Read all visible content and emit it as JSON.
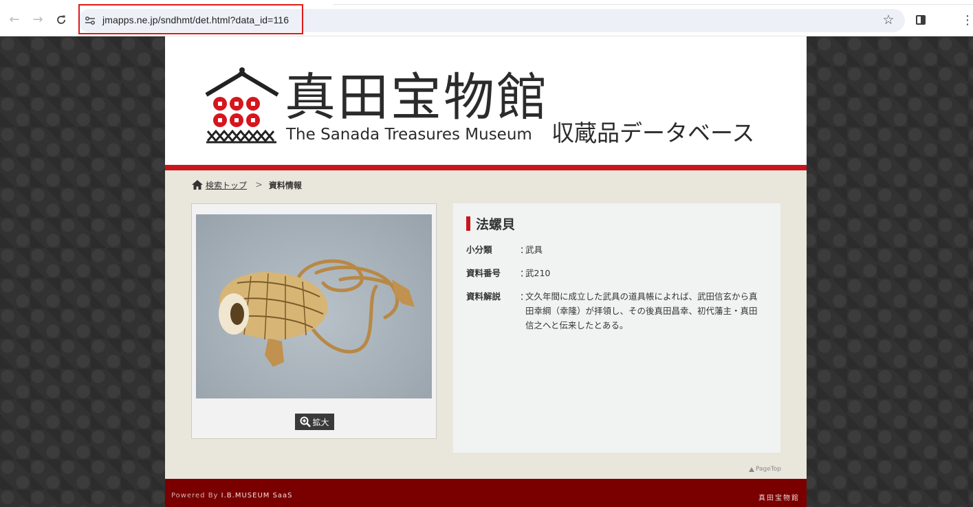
{
  "browser": {
    "url": "jmapps.ne.jp/sndhmt/det.html?data_id=116",
    "icons": {
      "back": "arrow-left-icon",
      "forward": "arrow-right-icon",
      "reload": "reload-icon",
      "site_info": "tune-icon",
      "bookmark": "star-icon",
      "side_panel": "side-panel-icon",
      "menu": "kebab-menu-icon"
    },
    "highlight_color": "#e01818"
  },
  "header": {
    "logo_jp": "真田宝物館",
    "logo_en": "The Sanada Treasures Museum",
    "db_title": "収蔵品データベース",
    "accent_color": "#c8161d"
  },
  "breadcrumb": {
    "home_link": "検索トップ",
    "separator": ">",
    "current": "資料情報"
  },
  "item": {
    "title": "法螺貝",
    "zoom_label": "拡大",
    "fields": [
      {
        "label": "小分類",
        "colon": "：",
        "value": "武具"
      },
      {
        "label": "資料番号",
        "colon": "：",
        "value": "武210"
      },
      {
        "label": "資料解説",
        "colon": "：",
        "value": "文久年間に成立した武具の道具帳によれば、武田信玄から真田幸綱（幸隆）が拝領し、その後真田昌幸、初代藩主・真田信之へと伝来したとある。"
      }
    ]
  },
  "pagetop": "PageTop",
  "footer": {
    "powered_by": "Powered By",
    "brand": "I.B.MUSEUM SaaS",
    "right_text": "真田宝物館",
    "color": "#7a0000"
  }
}
